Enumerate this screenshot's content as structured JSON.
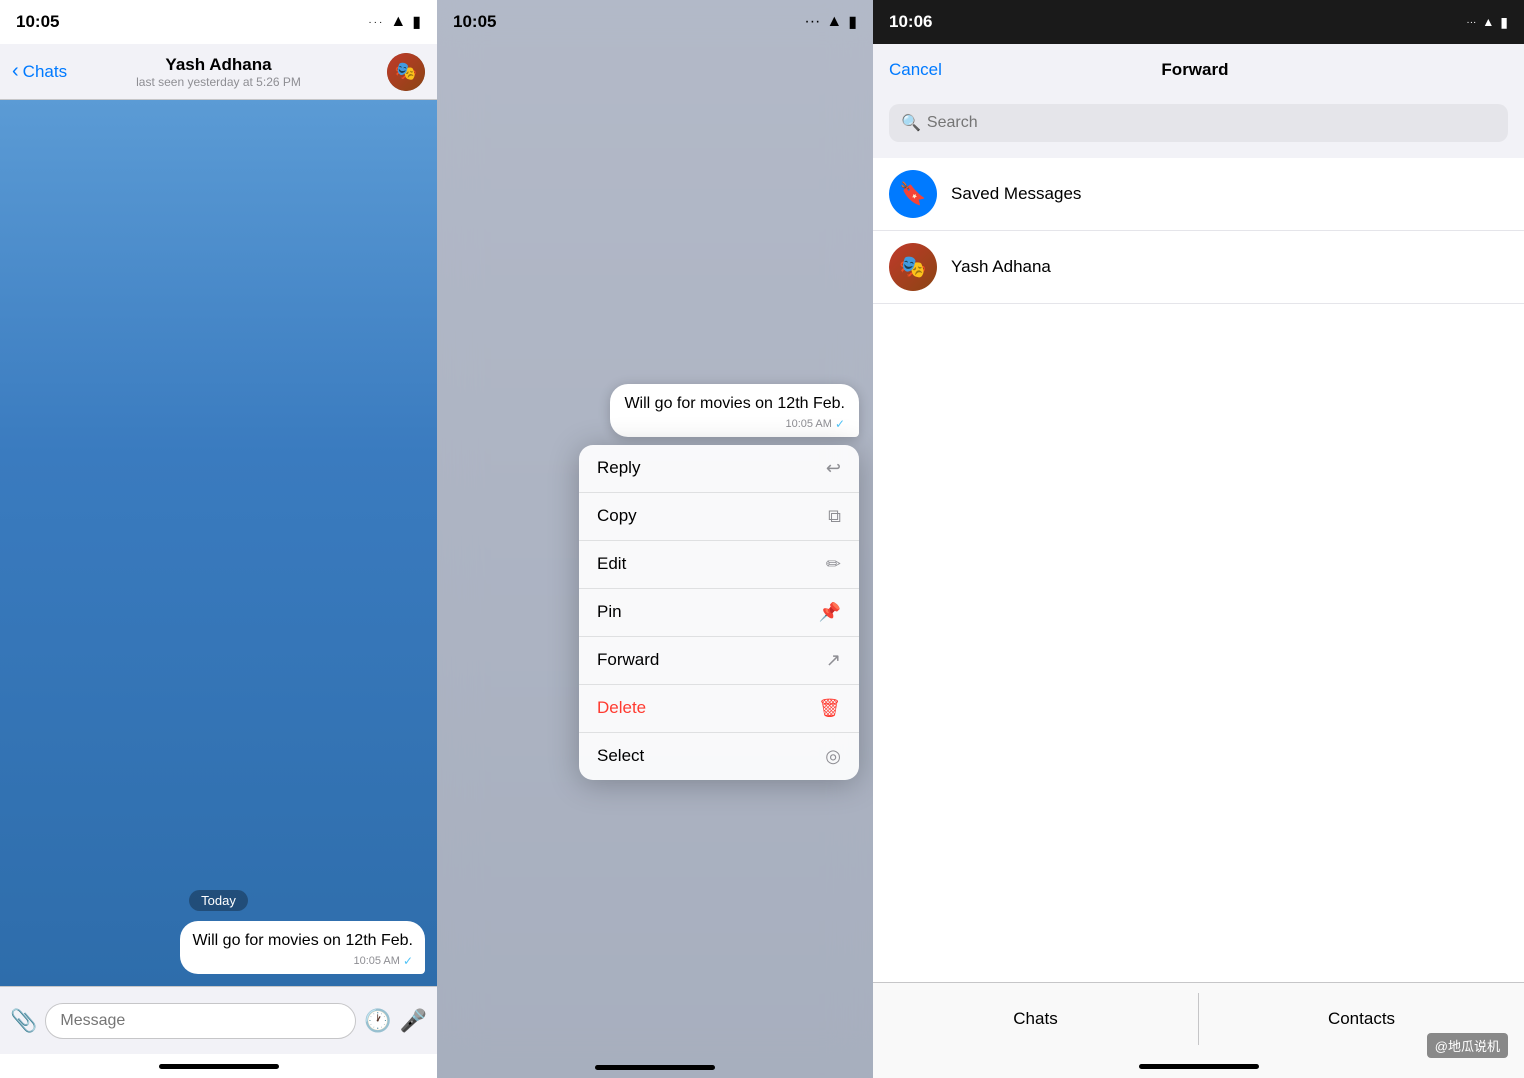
{
  "panel1": {
    "status_time": "10:05",
    "back_label": "Chats",
    "contact_name": "Yash Adhana",
    "contact_status": "last seen yesterday at 5:26 PM",
    "today_label": "Today",
    "message_text": "Will go for movies on 12th Feb.",
    "message_time": "10:05 AM",
    "input_placeholder": "Message"
  },
  "panel2": {
    "status_time": "10:05",
    "message_text": "Will go for movies on 12th Feb.",
    "message_time": "10:05 AM",
    "menu_items": [
      {
        "label": "Reply",
        "icon": "↩",
        "type": "normal"
      },
      {
        "label": "Copy",
        "icon": "⧉",
        "type": "normal"
      },
      {
        "label": "Edit",
        "icon": "✏",
        "type": "normal"
      },
      {
        "label": "Pin",
        "icon": "📌",
        "type": "normal"
      },
      {
        "label": "Forward",
        "icon": "↗",
        "type": "normal"
      },
      {
        "label": "Delete",
        "icon": "🗑",
        "type": "delete"
      },
      {
        "label": "Select",
        "icon": "◎",
        "type": "normal"
      }
    ]
  },
  "panel3": {
    "status_time": "10:06",
    "cancel_label": "Cancel",
    "forward_title": "Forward",
    "search_placeholder": "Search",
    "contacts": [
      {
        "name": "Saved Messages",
        "type": "saved"
      },
      {
        "name": "Yash Adhana",
        "type": "user"
      }
    ],
    "tabs": [
      "Chats",
      "Contacts"
    ],
    "watermark": "@地瓜说机"
  }
}
